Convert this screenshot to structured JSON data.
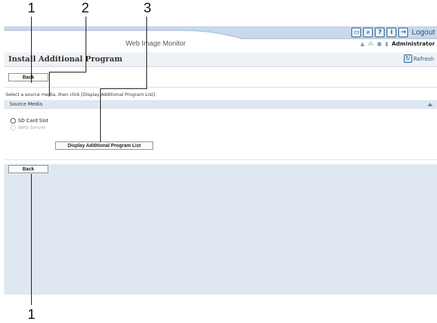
{
  "callouts": {
    "top": [
      "1",
      "2",
      "3"
    ],
    "bottom": "1"
  },
  "header": {
    "app_title": "Web Image Monitor",
    "logout_label": "Logout",
    "user_label": "Administrator",
    "icons": [
      "keyboard-icon",
      "search-icon",
      "help-icon",
      "info-icon",
      "logout-icon"
    ]
  },
  "page": {
    "title": "Install Additional Program",
    "refresh_label": "Refresh"
  },
  "actions": {
    "back_top_label": "Back",
    "back_bottom_label": "Back",
    "display_list_label": "Display Additional Program List"
  },
  "instructions": "Select a source media, then click [Display Additional Program List].",
  "source_media": {
    "section_label": "Source Media",
    "options": [
      {
        "label": "SD Card Slot",
        "enabled": true,
        "selected": false
      },
      {
        "label": "Web Server",
        "enabled": false,
        "selected": false
      }
    ]
  },
  "colors": {
    "accent": "#2d5b8a",
    "section_bg": "#dfe8f1",
    "header_swoosh": "#c9d9ea"
  }
}
